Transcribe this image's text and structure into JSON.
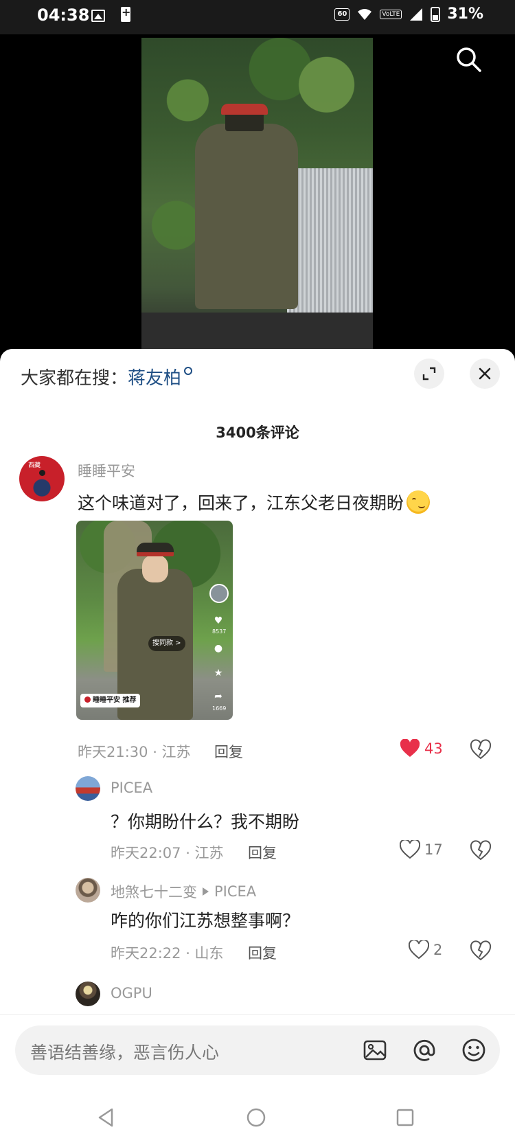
{
  "status_bar": {
    "time": "04:38",
    "refresh_rate": "60",
    "volte": "VoLTE",
    "battery": "31%"
  },
  "video": {
    "search_icon": "search-icon"
  },
  "panel": {
    "hot_search_prefix": "大家都在搜：",
    "hot_search_keyword": "蒋友柏",
    "comment_count": "3400条评论"
  },
  "comments": [
    {
      "username": "睡睡平安",
      "text": "这个味道对了，回来了，江东父老日夜期盼",
      "emoji": "smiling-face-emoji",
      "image": {
        "search_pill": "搜同款 >",
        "rec_pill": "睡睡平安 推荐",
        "like_count": "8537",
        "share_count": "1669"
      },
      "meta": "昨天21:30 · 江苏",
      "reply_label": "回复",
      "likes": "43",
      "liked": true,
      "like_color": "#e8304a"
    },
    {
      "username": "PICEA",
      "text": "？你期盼什么？我不期盼",
      "meta": "昨天22:07 · 江苏",
      "reply_label": "回复",
      "likes": "17",
      "liked": false
    },
    {
      "username": "地煞七十二变",
      "reply_to": "PICEA",
      "text": "咋的你们江苏想整事啊？",
      "meta": "昨天22:22 · 山东",
      "reply_label": "回复",
      "likes": "2",
      "liked": false
    },
    {
      "username": "OGPU"
    }
  ],
  "input": {
    "placeholder": "善语结善缘，恶言伤人心"
  }
}
